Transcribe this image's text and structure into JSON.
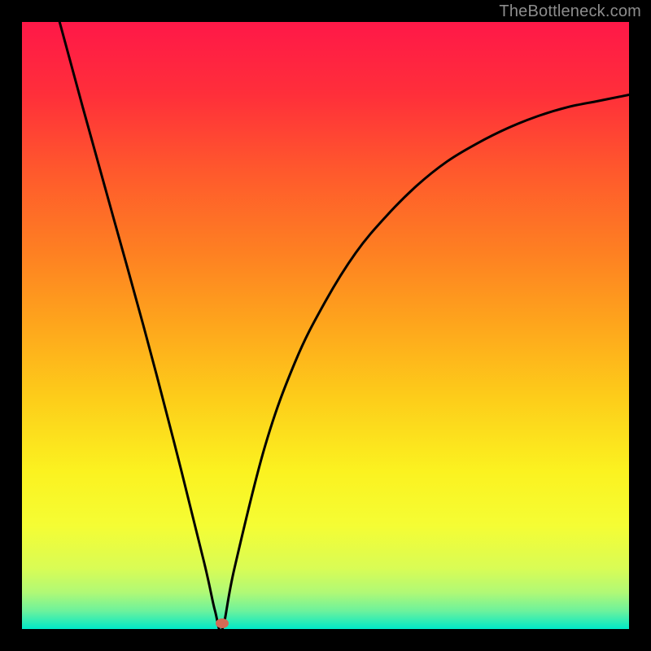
{
  "watermark": {
    "text": "TheBottleneck.com"
  },
  "gradient": {
    "stops": [
      {
        "offset": 0.0,
        "color": "#ff1848"
      },
      {
        "offset": 0.12,
        "color": "#ff2f3a"
      },
      {
        "offset": 0.25,
        "color": "#ff5a2c"
      },
      {
        "offset": 0.38,
        "color": "#fe8022"
      },
      {
        "offset": 0.5,
        "color": "#fea61c"
      },
      {
        "offset": 0.62,
        "color": "#fdcd1a"
      },
      {
        "offset": 0.74,
        "color": "#fbf220"
      },
      {
        "offset": 0.83,
        "color": "#f5fd34"
      },
      {
        "offset": 0.9,
        "color": "#d9fc55"
      },
      {
        "offset": 0.94,
        "color": "#b0f976"
      },
      {
        "offset": 0.97,
        "color": "#6df29c"
      },
      {
        "offset": 1.0,
        "color": "#00e8c8"
      }
    ]
  },
  "marker": {
    "x_percent": 33.0,
    "y_percent": 99.0,
    "color": "#d46a55"
  },
  "chart_data": {
    "type": "line",
    "title": "",
    "xlabel": "",
    "ylabel": "",
    "xlim": [
      0,
      100
    ],
    "ylim": [
      0,
      100
    ],
    "series": [
      {
        "name": "bottleneck-curve",
        "x": [
          6.2,
          10,
          15,
          20,
          25,
          30,
          31.8,
          33,
          35,
          40,
          45,
          50,
          55,
          60,
          65,
          70,
          75,
          80,
          85,
          90,
          95,
          100
        ],
        "y": [
          100,
          86,
          68,
          50,
          31,
          11,
          3,
          0,
          10,
          30,
          44,
          54,
          62,
          68,
          73,
          77,
          80,
          82.5,
          84.5,
          86,
          87,
          88
        ]
      }
    ],
    "annotations": [
      {
        "type": "point",
        "name": "minimum-marker",
        "x": 33,
        "y": 1
      }
    ]
  }
}
